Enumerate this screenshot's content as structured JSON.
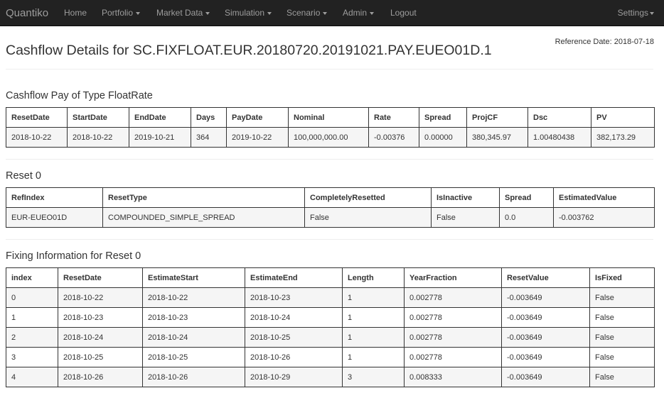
{
  "navbar": {
    "brand": "Quantiko",
    "items": [
      {
        "label": "Home",
        "dropdown": false
      },
      {
        "label": "Portfolio",
        "dropdown": true
      },
      {
        "label": "Market Data",
        "dropdown": true
      },
      {
        "label": "Simulation",
        "dropdown": true
      },
      {
        "label": "Scenario",
        "dropdown": true
      },
      {
        "label": "Admin",
        "dropdown": true
      },
      {
        "label": "Logout",
        "dropdown": false
      }
    ],
    "settings": {
      "label": "Settings",
      "dropdown": true
    }
  },
  "reference_date": "Reference Date: 2018-07-18",
  "page_title": "Cashflow Details for SC.FIXFLOAT.EUR.20180720.20191021.PAY.EUEO01D.1",
  "cashflow": {
    "title": "Cashflow Pay of Type FloatRate",
    "columns": [
      "ResetDate",
      "StartDate",
      "EndDate",
      "Days",
      "PayDate",
      "Nominal",
      "Rate",
      "Spread",
      "ProjCF",
      "Dsc",
      "PV"
    ],
    "rows": [
      [
        "2018-10-22",
        "2018-10-22",
        "2019-10-21",
        "364",
        "2019-10-22",
        "100,000,000.00",
        "-0.00376",
        "0.00000",
        "380,345.97",
        "1.00480438",
        "382,173.29"
      ]
    ]
  },
  "reset": {
    "title": "Reset 0",
    "columns": [
      "RefIndex",
      "ResetType",
      "CompletelyResetted",
      "IsInactive",
      "Spread",
      "EstimatedValue"
    ],
    "rows": [
      [
        "EUR-EUEO01D",
        "COMPOUNDED_SIMPLE_SPREAD",
        "False",
        "False",
        "0.0",
        "-0.003762"
      ]
    ]
  },
  "fixing": {
    "title": "Fixing Information for Reset 0",
    "columns": [
      "index",
      "ResetDate",
      "EstimateStart",
      "EstimateEnd",
      "Length",
      "YearFraction",
      "ResetValue",
      "IsFixed"
    ],
    "rows": [
      [
        "0",
        "2018-10-22",
        "2018-10-22",
        "2018-10-23",
        "1",
        "0.002778",
        "-0.003649",
        "False"
      ],
      [
        "1",
        "2018-10-23",
        "2018-10-23",
        "2018-10-24",
        "1",
        "0.002778",
        "-0.003649",
        "False"
      ],
      [
        "2",
        "2018-10-24",
        "2018-10-24",
        "2018-10-25",
        "1",
        "0.002778",
        "-0.003649",
        "False"
      ],
      [
        "3",
        "2018-10-25",
        "2018-10-25",
        "2018-10-26",
        "1",
        "0.002778",
        "-0.003649",
        "False"
      ],
      [
        "4",
        "2018-10-26",
        "2018-10-26",
        "2018-10-29",
        "3",
        "0.008333",
        "-0.003649",
        "False"
      ]
    ]
  }
}
